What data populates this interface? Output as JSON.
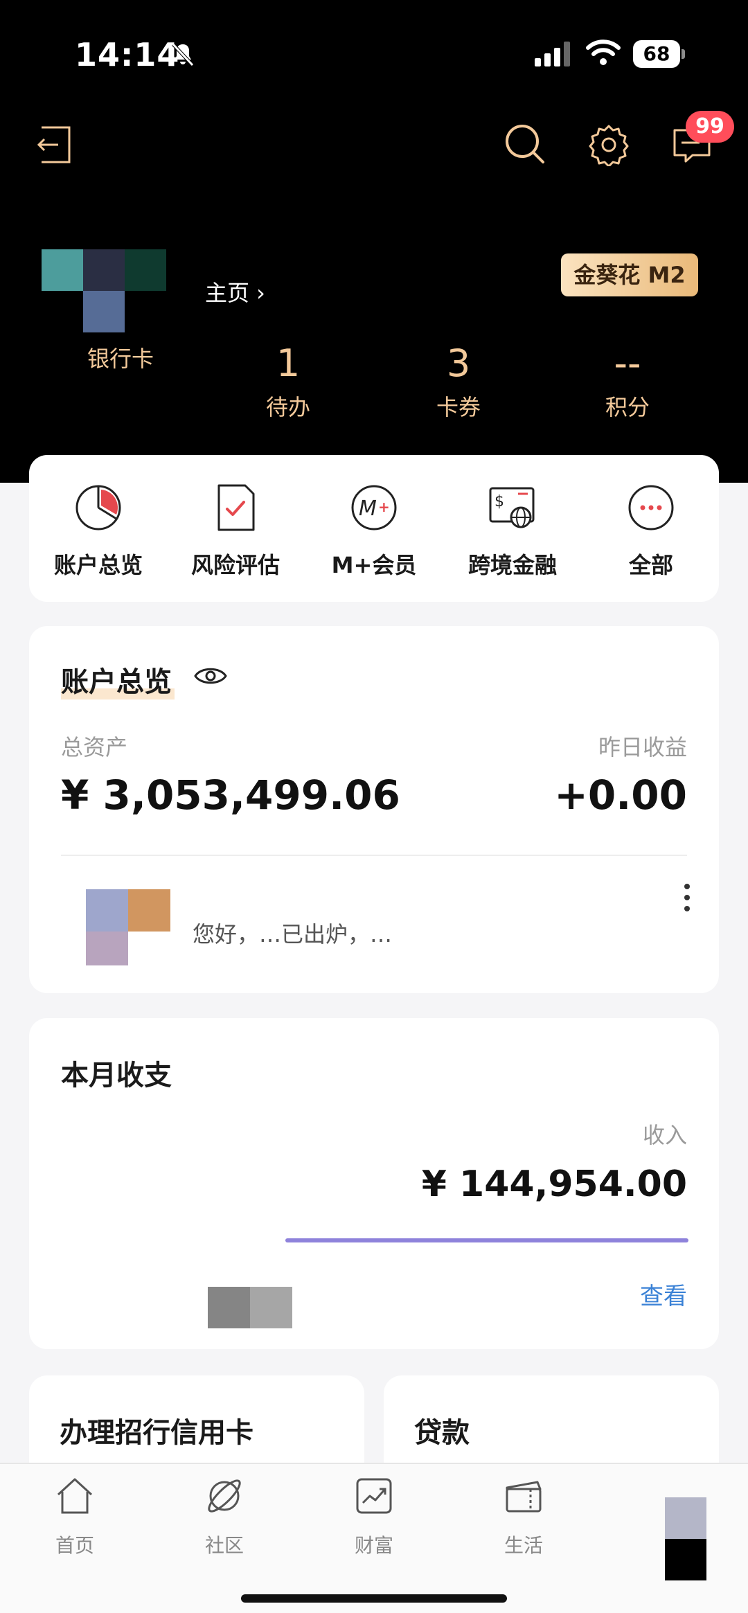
{
  "status_bar": {
    "time": "14:14",
    "battery": "68"
  },
  "header": {
    "badge_count": "99",
    "homepage_link": "主页 ›",
    "level_badge": "金葵花 M2"
  },
  "stats": [
    {
      "value": "",
      "label": "银行卡"
    },
    {
      "value": "1",
      "label": "待办"
    },
    {
      "value": "3",
      "label": "卡券"
    },
    {
      "value": "--",
      "label": "积分"
    }
  ],
  "quick_menu": [
    {
      "label": "账户总览",
      "icon": "pie-chart-icon"
    },
    {
      "label": "风险评估",
      "icon": "checklist-icon"
    },
    {
      "label": "M+会员",
      "icon": "member-plus-icon"
    },
    {
      "label": "跨境金融",
      "icon": "cross-border-icon"
    },
    {
      "label": "全部",
      "icon": "more-dots-icon"
    }
  ],
  "overview": {
    "title": "账户总览",
    "total_assets_label": "总资产",
    "total_assets_value": "¥ 3,053,499.06",
    "yesterday_label": "昨日收益",
    "yesterday_value": "+0.00",
    "notice_text": "您好，…已出炉，…"
  },
  "monthly": {
    "title": "本月收支",
    "income_label": "收入",
    "income_value": "¥ 144,954.00",
    "view_label": "查看"
  },
  "promos": {
    "left_title": "办理招行信用卡",
    "right_title": "贷款"
  },
  "tabs": [
    {
      "label": "首页",
      "icon": "home-icon"
    },
    {
      "label": "社区",
      "icon": "community-icon"
    },
    {
      "label": "财富",
      "icon": "wealth-icon"
    },
    {
      "label": "生活",
      "icon": "life-icon"
    }
  ],
  "colors": {
    "accent_gold": "#f3c99a",
    "badge_red": "#ff4d5a",
    "link_blue": "#3b82d6",
    "income_bar": "#8e82db"
  }
}
